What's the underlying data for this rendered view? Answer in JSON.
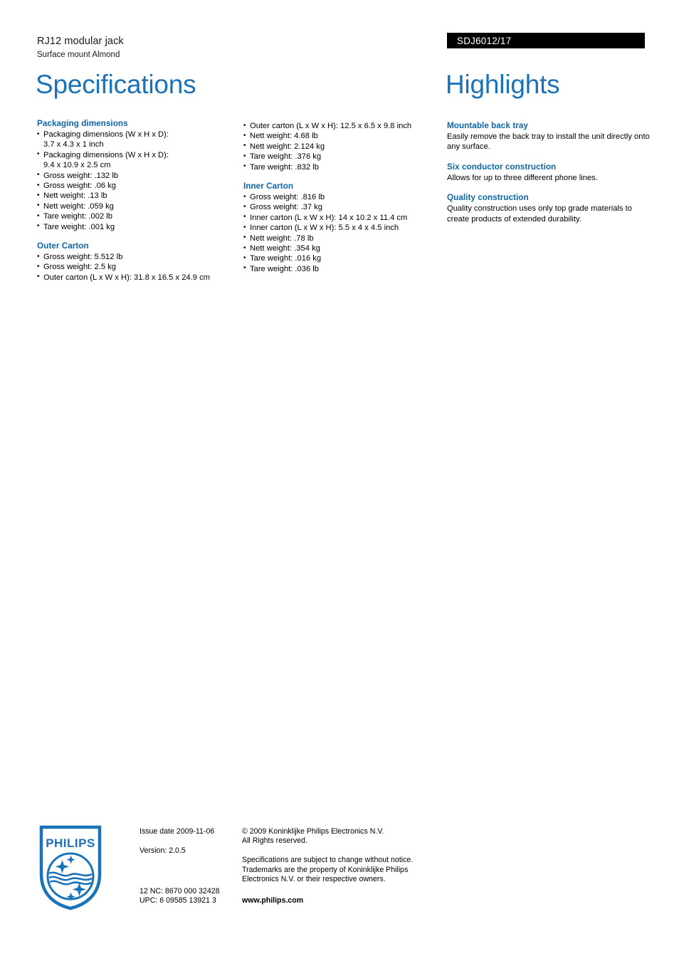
{
  "header": {
    "product_name": "RJ12 modular jack",
    "product_subtitle": "Surface mount Almond",
    "model_number": "SDJ6012/17",
    "spec_title": "Specifications",
    "highlights_title": "Highlights"
  },
  "colors": {
    "heading_blue": "#0d65a8",
    "title_blue": "#1a72b8",
    "model_bar_bg": "#000000",
    "model_bar_text": "#ffffff"
  },
  "specifications": {
    "left_column": [
      {
        "heading": "Packaging dimensions",
        "items": [
          {
            "text": "Packaging dimensions (W x H x D):",
            "cont": "3.7 x 4.3 x 1 inch"
          },
          {
            "text": "Packaging dimensions (W x H x D):",
            "cont": "9.4 x 10.9 x 2.5 cm"
          },
          {
            "text": "Gross weight: .132 lb"
          },
          {
            "text": "Gross weight: .06 kg"
          },
          {
            "text": "Nett weight: .13 lb"
          },
          {
            "text": "Nett weight: .059 kg"
          },
          {
            "text": "Tare weight: .002 lb"
          },
          {
            "text": "Tare weight: .001 kg"
          }
        ]
      },
      {
        "heading": "Outer Carton",
        "items": [
          {
            "text": "Gross weight: 5.512 lb"
          },
          {
            "text": "Gross weight: 2.5 kg"
          },
          {
            "text": "Outer carton (L x W x H): 31.8 x 16.5 x 24.9 cm"
          }
        ]
      }
    ],
    "middle_column": [
      {
        "heading": "",
        "items": [
          {
            "text": "Outer carton (L x W x H): 12.5 x 6.5 x 9.8 inch"
          },
          {
            "text": "Nett weight: 4.68 lb"
          },
          {
            "text": "Nett weight: 2.124 kg"
          },
          {
            "text": "Tare weight: .376 kg"
          },
          {
            "text": "Tare weight: .832 lb"
          }
        ]
      },
      {
        "heading": "Inner Carton",
        "items": [
          {
            "text": "Gross weight: .816 lb"
          },
          {
            "text": "Gross weight: .37 kg"
          },
          {
            "text": "Inner carton (L x W x H): 14 x 10.2 x 11.4 cm"
          },
          {
            "text": "Inner carton (L x W x H): 5.5 x 4 x 4.5 inch"
          },
          {
            "text": "Nett weight: .78 lb"
          },
          {
            "text": "Nett weight: .354 kg"
          },
          {
            "text": "Tare weight: .016 kg"
          },
          {
            "text": "Tare weight: .036 lb"
          }
        ]
      }
    ]
  },
  "highlights": [
    {
      "heading": "Mountable back tray",
      "body": "Easily remove the back tray to install the unit directly onto any surface."
    },
    {
      "heading": "Six conductor construction",
      "body": "Allows for up to three different phone lines."
    },
    {
      "heading": "Quality construction",
      "body": "Quality construction uses only top grade materials to create products of extended durability."
    }
  ],
  "footer": {
    "logo_wordmark": "PHILIPS",
    "issue_date": "Issue date 2009-11-06",
    "version": "Version: 2.0.5",
    "twelve_nc": "12 NC: 8670 000 32428",
    "upc": "UPC: 6 09585 13921 3",
    "copyright_line1": "© 2009 Koninklijke Philips Electronics N.V.",
    "copyright_line2": "All Rights reserved.",
    "disclaimer": "Specifications are subject to change without notice. Trademarks are the property of Koninklijke Philips Electronics N.V. or their respective owners.",
    "website": "www.philips.com"
  }
}
